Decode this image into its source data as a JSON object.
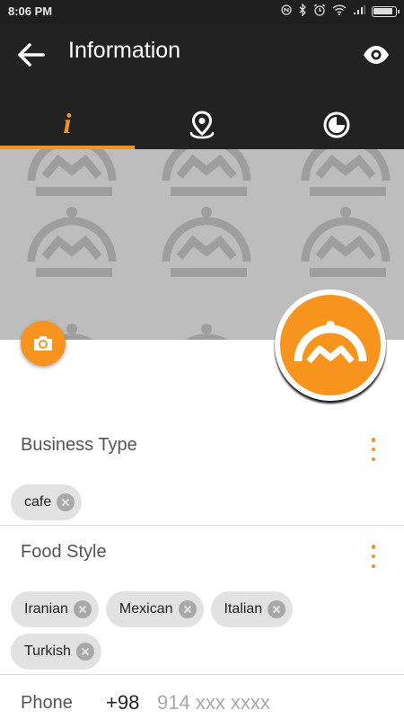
{
  "status_bar": {
    "time": "8:06 PM",
    "icons": [
      "nfc-icon",
      "bluetooth-icon",
      "alarm-icon",
      "wifi-icon",
      "signal-icon",
      "battery-icon"
    ],
    "battery_level": 0.9
  },
  "app_bar": {
    "title": "Information",
    "back_icon": "arrow-left-icon",
    "action_icon": "eye-icon"
  },
  "tabs": [
    {
      "id": "info",
      "icon": "info-icon",
      "glyph": "i",
      "active": true
    },
    {
      "id": "location",
      "icon": "map-pin-icon",
      "active": false
    },
    {
      "id": "hours",
      "icon": "clock-icon",
      "active": false
    }
  ],
  "colors": {
    "accent": "#f7941d",
    "app_bar": "#222222",
    "cover": "#bdbdbd",
    "chip": "#e2e2e2"
  },
  "business_type": {
    "label": "Business Type",
    "chips": [
      "cafe"
    ]
  },
  "food_style": {
    "label": "Food Style",
    "chips": [
      "Iranian",
      "Mexican",
      "Italian",
      "Turkish"
    ]
  },
  "phone": {
    "label": "Phone",
    "country_code": "+98",
    "placeholder": "914 xxx xxxx"
  }
}
